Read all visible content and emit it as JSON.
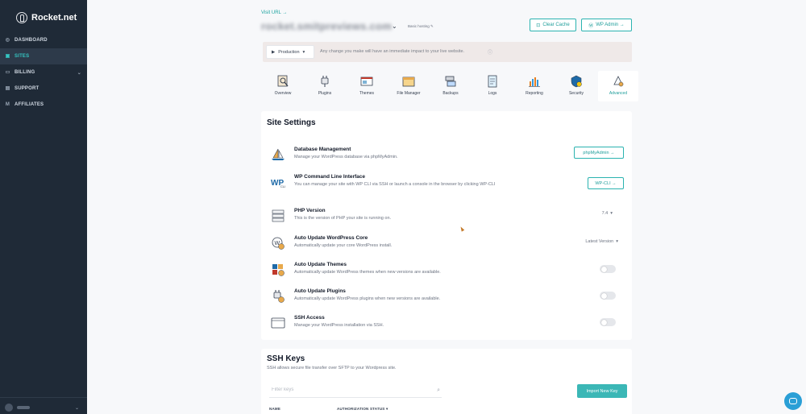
{
  "sidebar": {
    "brand": "Rocket.net",
    "items": [
      {
        "label": "DASHBOARD",
        "icon": "dashboard-icon"
      },
      {
        "label": "SITES",
        "icon": "sites-icon"
      },
      {
        "label": "BILLING",
        "icon": "billing-icon"
      },
      {
        "label": "SUPPORT",
        "icon": "support-icon"
      },
      {
        "label": "AFFILIATES",
        "icon": "affiliates-icon"
      }
    ],
    "active": "SITES"
  },
  "header": {
    "visit_url": "Visit URL →",
    "domain": "rocket.smitpreviews.com",
    "plan_tag": "Basic hosting",
    "clear_cache": "Clear Cache",
    "wp_admin": "WP Admin →"
  },
  "environment": {
    "selected": "Production",
    "message": "Any change you make will have an immediate impact to your live website."
  },
  "tabs": [
    {
      "label": "Overview",
      "icon": "overview-icon"
    },
    {
      "label": "Plugins",
      "icon": "plugins-icon"
    },
    {
      "label": "Themes",
      "icon": "themes-icon"
    },
    {
      "label": "File Manager",
      "icon": "file-manager-icon"
    },
    {
      "label": "Backups",
      "icon": "backups-icon"
    },
    {
      "label": "Logs",
      "icon": "logs-icon"
    },
    {
      "label": "Reporting",
      "icon": "reporting-icon"
    },
    {
      "label": "Security",
      "icon": "security-icon"
    },
    {
      "label": "Advanced",
      "icon": "advanced-icon"
    }
  ],
  "active_tab": "Advanced",
  "site_settings": {
    "title": "Site Settings",
    "items": [
      {
        "title": "Database Management",
        "desc": "Manage your WordPress database via phpMyAdmin.",
        "action": "phpMyAdmin →"
      },
      {
        "title": "WP Command Line Interface",
        "desc": "You can manage your site with WP CLI via SSH or launch a console in the browser by clicking WP-CLI",
        "action": "WP-CLI →"
      },
      {
        "title": "PHP Version",
        "desc": "This is the version of PHP your site is running on.",
        "value": "7.4"
      },
      {
        "title": "Auto Update WordPress Core",
        "desc": "Automatically update your core WordPress install.",
        "value": "Latest Version"
      },
      {
        "title": "Auto Update Themes",
        "desc": "Automatically update WordPress themes when new versions are available.",
        "toggle": false
      },
      {
        "title": "Auto Update Plugins",
        "desc": "Automatically update WordPress plugins when new versions are available.",
        "toggle": false
      },
      {
        "title": "SSH Access",
        "desc": "Manage your WordPress installation via SSH.",
        "toggle": false
      }
    ]
  },
  "ssh_keys": {
    "title": "SSH Keys",
    "subtitle": "SSH allows secure file transfer over SFTP to your Wordpress site.",
    "search_placeholder": "Filter keys",
    "import_label": "Import New Key",
    "columns": [
      "NAME",
      "AUTHORIZATION STATUS"
    ]
  },
  "colors": {
    "accent": "#2bb3b0",
    "sidebar_bg": "#1f2a37",
    "chat": "#2a9fd6"
  }
}
